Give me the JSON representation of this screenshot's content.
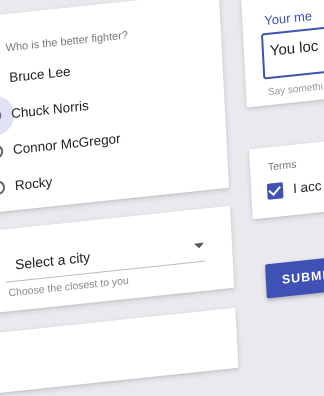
{
  "radio_group": {
    "question": "Who is the better fighter?",
    "options": [
      "Bruce Lee",
      "Chuck Norris",
      "Connor McGregor",
      "Rocky"
    ],
    "selected": "Chuck Norris"
  },
  "city_select": {
    "value": "Select a city",
    "helper": "Choose the closest to you"
  },
  "text_field": {
    "label": "Your me",
    "value": "You loc",
    "helper": "Say somethi"
  },
  "terms": {
    "label": "Terms",
    "text": "I acc",
    "checked": true
  },
  "submit": {
    "label": "SUBMIT"
  },
  "colors": {
    "accent": "#3f51b5"
  }
}
